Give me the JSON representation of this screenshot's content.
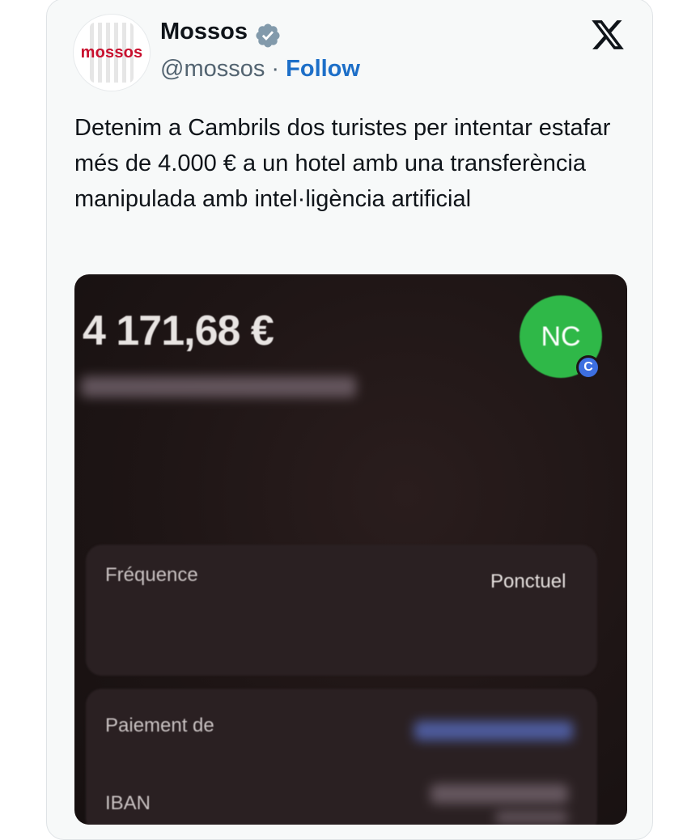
{
  "tweet": {
    "display_name": "Mossos",
    "handle": "@mossos",
    "separator": " · ",
    "follow_label": "Follow",
    "avatar_logo_text": "mossos",
    "text": "Detenim a Cambrils dos turistes per intentar estafar més de 4.000 € a un hotel amb una transferència manipulada amb intel·ligència artificial"
  },
  "photo": {
    "amount": "4 171,68 €",
    "avatar_initials": "NC",
    "avatar_badge": "C",
    "frequency_label": "Fréquence",
    "frequency_value": "Ponctuel",
    "payment_label": "Paiement de",
    "iban_label": "IBAN"
  },
  "colors": {
    "follow_blue": "#1d6fc8",
    "brand_red": "#c8102e",
    "nc_green": "#2fb848"
  },
  "icons": {
    "verified": "verified-badge-icon",
    "platform": "x-logo-icon"
  }
}
